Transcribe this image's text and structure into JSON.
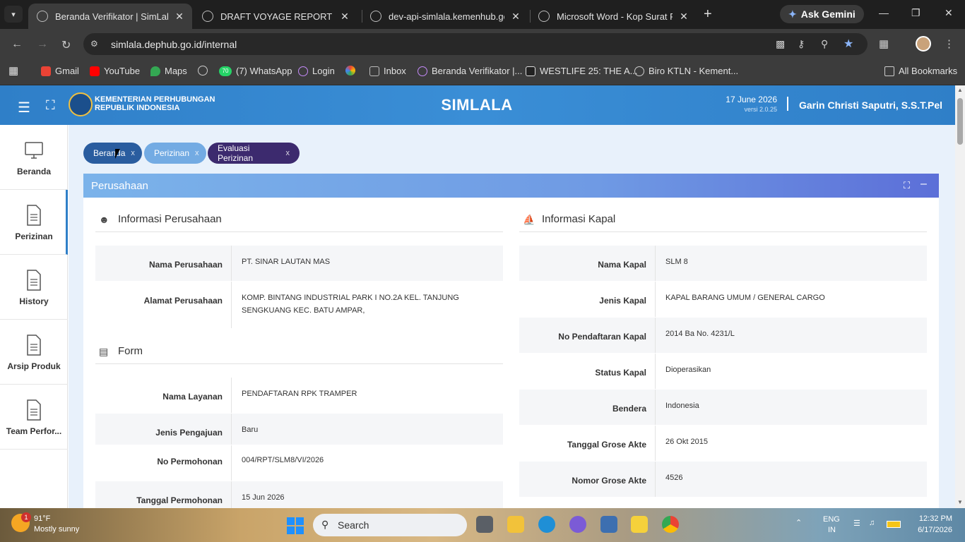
{
  "browser": {
    "tabs": [
      {
        "title": "Beranda Verifikator | SimLala",
        "active": true
      },
      {
        "title": "DRAFT VOYAGE REPORT JUNI.xl",
        "active": false
      },
      {
        "title": "dev-api-simlala.kemenhub.go.id",
        "active": false
      },
      {
        "title": "Microsoft Word - Kop Surat Pt.",
        "active": false
      }
    ],
    "ask_gemini": "Ask Gemini",
    "url": "simlala.dephub.go.id/internal",
    "bookmarks": [
      "Gmail",
      "YouTube",
      "Maps",
      "(7) WhatsApp",
      "Login",
      "Inbox",
      "Beranda Verifikator |...",
      "WESTLIFE 25: THE A...",
      "Biro KTLN - Kement..."
    ],
    "whatsapp_badge": "70",
    "all_bookmarks": "All Bookmarks"
  },
  "header": {
    "org_line1": "KEMENTERIAN PERHUBUNGAN",
    "org_line2": "REPUBLIK INDONESIA",
    "app_title": "SIMLALA",
    "date": "17 June 2026",
    "version": "versi 2.0.25",
    "user": "Garin Christi Saputri, S.S.T.Pel"
  },
  "sidebar": [
    {
      "label": "Beranda",
      "icon": "monitor-icon"
    },
    {
      "label": "Perizinan",
      "icon": "document-icon"
    },
    {
      "label": "History",
      "icon": "document-icon"
    },
    {
      "label": "Arsip Produk",
      "icon": "document-icon"
    },
    {
      "label": "Team Perfor...",
      "icon": "document-icon"
    }
  ],
  "pills": [
    {
      "label": "Beranda",
      "close": "x"
    },
    {
      "label": "Perizinan",
      "close": "x"
    },
    {
      "label": "Evaluasi Perizinan",
      "close": "x"
    }
  ],
  "card": {
    "title": "Perusahaan",
    "left_section_title": "Informasi Perusahaan",
    "left_rows": [
      {
        "label": "Nama Perusahaan",
        "value": "PT. SINAR LAUTAN MAS"
      },
      {
        "label": "Alamat Perusahaan",
        "value": "KOMP. BINTANG INDUSTRIAL PARK I NO.2A KEL. TANJUNG SENGKUANG KEC. BATU AMPAR,"
      }
    ],
    "form_section_title": "Form",
    "form_rows": [
      {
        "label": "Nama Layanan",
        "value": "PENDAFTARAN RPK TRAMPER"
      },
      {
        "label": "Jenis Pengajuan",
        "value": "Baru"
      },
      {
        "label": "No Permohonan",
        "value": "004/RPT/SLM8/VI/2026"
      },
      {
        "label": "Tanggal Permohonan",
        "value": "15 Jun 2026"
      }
    ],
    "right_section_title": "Informasi Kapal",
    "right_rows": [
      {
        "label": "Nama Kapal",
        "value": "SLM 8"
      },
      {
        "label": "Jenis Kapal",
        "value": "KAPAL BARANG UMUM / GENERAL CARGO"
      },
      {
        "label": "No Pendaftaran Kapal",
        "value": "2014 Ba No. 4231/L"
      },
      {
        "label": "Status Kapal",
        "value": "Dioperasikan"
      },
      {
        "label": "Bendera",
        "value": "Indonesia"
      },
      {
        "label": "Tanggal Grose Akte",
        "value": "26 Okt 2015"
      },
      {
        "label": "Nomor Grose Akte",
        "value": "4526"
      }
    ]
  },
  "taskbar": {
    "weather_badge": "1",
    "temp": "91°F",
    "weather": "Mostly sunny",
    "search": "Search",
    "lang1": "ENG",
    "lang2": "IN",
    "time": "12:32 PM",
    "date": "6/17/2026"
  }
}
